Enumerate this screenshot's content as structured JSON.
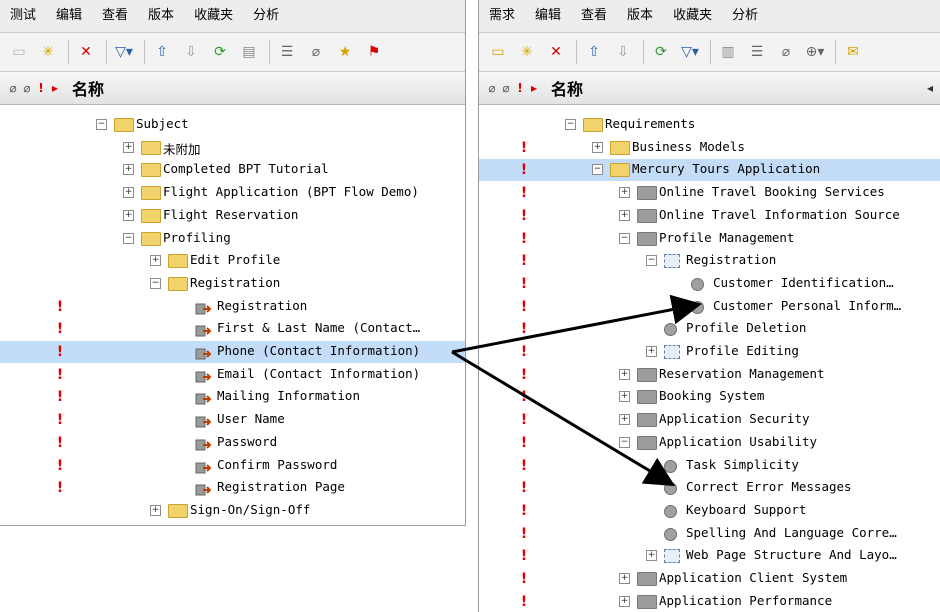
{
  "left": {
    "menu": [
      "测试",
      "编辑",
      "查看",
      "版本",
      "收藏夹",
      "分析"
    ],
    "column_name": "名称",
    "tree": [
      {
        "label": "Subject",
        "level": 0,
        "type": "folder-open",
        "exp": "-"
      },
      {
        "label": "未附加",
        "level": 1,
        "type": "folder",
        "exp": "+"
      },
      {
        "label": "Completed BPT Tutorial",
        "level": 1,
        "type": "folder",
        "exp": "+"
      },
      {
        "label": "Flight Application (BPT Flow Demo)",
        "level": 1,
        "type": "folder",
        "exp": "+"
      },
      {
        "label": "Flight Reservation",
        "level": 1,
        "type": "folder",
        "exp": "+"
      },
      {
        "label": "Profiling",
        "level": 1,
        "type": "folder-open",
        "exp": "-"
      },
      {
        "label": "Edit Profile",
        "level": 2,
        "type": "folder",
        "exp": "+"
      },
      {
        "label": "Registration",
        "level": 2,
        "type": "folder-open",
        "exp": "-"
      },
      {
        "label": "Registration",
        "level": 3,
        "type": "step",
        "flag": true
      },
      {
        "label": "First & Last Name (Contact…",
        "level": 3,
        "type": "step",
        "flag": true
      },
      {
        "label": "Phone (Contact Information)",
        "level": 3,
        "type": "step",
        "flag": true,
        "selected": true
      },
      {
        "label": "Email (Contact Information)",
        "level": 3,
        "type": "step",
        "flag": true
      },
      {
        "label": "Mailing Information",
        "level": 3,
        "type": "step",
        "flag": true
      },
      {
        "label": "User Name",
        "level": 3,
        "type": "step",
        "flag": true
      },
      {
        "label": "Password",
        "level": 3,
        "type": "step",
        "flag": true
      },
      {
        "label": "Confirm Password",
        "level": 3,
        "type": "step",
        "flag": true
      },
      {
        "label": "Registration Page",
        "level": 3,
        "type": "step",
        "flag": true
      },
      {
        "label": "Sign-On/Sign-Off",
        "level": 2,
        "type": "folder",
        "exp": "+"
      }
    ]
  },
  "right": {
    "menu": [
      "需求",
      "编辑",
      "查看",
      "版本",
      "收藏夹",
      "分析"
    ],
    "column_name": "名称",
    "tree": [
      {
        "label": "Requirements",
        "level": 0,
        "type": "folder-open",
        "exp": "-"
      },
      {
        "label": "Business Models",
        "level": 1,
        "type": "folder",
        "exp": "+",
        "flag": true
      },
      {
        "label": "Mercury Tours Application",
        "level": 1,
        "type": "folder-open",
        "exp": "-",
        "flag": true,
        "selected": true
      },
      {
        "label": "Online Travel Booking Services",
        "level": 2,
        "type": "gray",
        "exp": "+",
        "flag": true
      },
      {
        "label": "Online Travel Information Source",
        "level": 2,
        "type": "gray",
        "exp": "+",
        "flag": true
      },
      {
        "label": "Profile Management",
        "level": 2,
        "type": "gray",
        "exp": "-",
        "flag": true
      },
      {
        "label": "Registration",
        "level": 3,
        "type": "dotted",
        "exp": "-",
        "flag": true
      },
      {
        "label": "Customer Identification…",
        "level": 4,
        "type": "circle",
        "flag": true
      },
      {
        "label": "Customer Personal Inform…",
        "level": 4,
        "type": "circle",
        "flag": true
      },
      {
        "label": "Profile Deletion",
        "level": 3,
        "type": "circle",
        "flag": true
      },
      {
        "label": "Profile Editing",
        "level": 3,
        "type": "dotted",
        "exp": "+",
        "flag": true
      },
      {
        "label": "Reservation Management",
        "level": 2,
        "type": "gray",
        "exp": "+",
        "flag": true
      },
      {
        "label": "Booking System",
        "level": 2,
        "type": "gray",
        "exp": "+",
        "flag": true
      },
      {
        "label": "Application Security",
        "level": 2,
        "type": "gray",
        "exp": "+",
        "flag": true
      },
      {
        "label": "Application Usability",
        "level": 2,
        "type": "gray",
        "exp": "-",
        "flag": true
      },
      {
        "label": "Task Simplicity",
        "level": 3,
        "type": "circle",
        "flag": true
      },
      {
        "label": "Correct Error Messages",
        "level": 3,
        "type": "circle",
        "flag": true
      },
      {
        "label": "Keyboard Support",
        "level": 3,
        "type": "circle",
        "flag": true
      },
      {
        "label": "Spelling And Language Corre…",
        "level": 3,
        "type": "circle",
        "flag": true
      },
      {
        "label": "Web Page Structure And Layo…",
        "level": 3,
        "type": "dotted",
        "exp": "+",
        "flag": true
      },
      {
        "label": "Application Client System",
        "level": 2,
        "type": "gray",
        "exp": "+",
        "flag": true
      },
      {
        "label": "Application Performance",
        "level": 2,
        "type": "gray",
        "exp": "+",
        "flag": true
      }
    ]
  }
}
